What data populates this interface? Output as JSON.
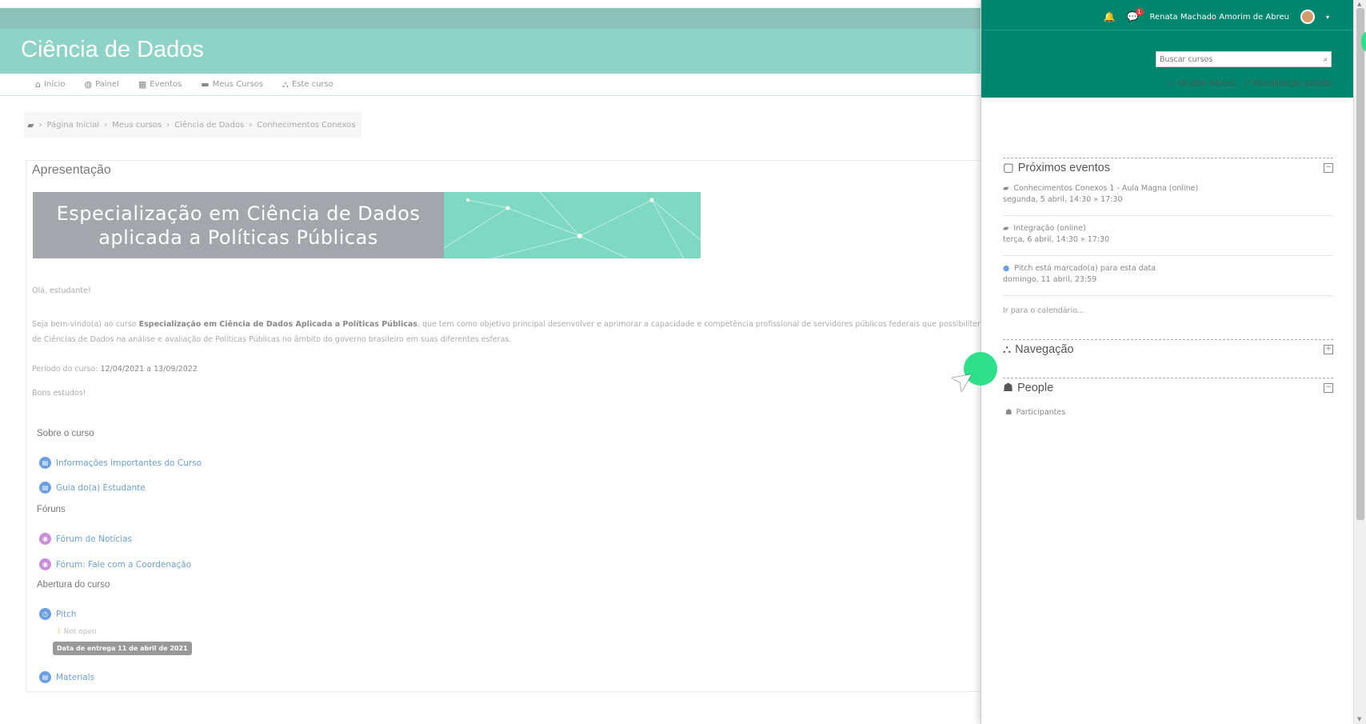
{
  "site": {
    "title": "Ciência de Dados"
  },
  "nav": [
    {
      "icon": "home-icon",
      "glyph": "⌂",
      "label": "Início"
    },
    {
      "icon": "dashboard-icon",
      "glyph": "◍",
      "label": "Painel"
    },
    {
      "icon": "calendar-icon",
      "glyph": "▦",
      "label": "Eventos"
    },
    {
      "icon": "courses-icon",
      "glyph": "▬",
      "label": "Meus Cursos"
    },
    {
      "icon": "sitemap-icon",
      "glyph": "⛬",
      "label": "Este curso"
    }
  ],
  "breadcrumb": {
    "items": [
      "Página Inicial",
      "Meus cursos",
      "Ciência de Dados",
      "Conhecimentos Conexos"
    ]
  },
  "main": {
    "section_title": "Apresentação",
    "banner": {
      "line1": "Especialização em Ciência de Dados",
      "line2": "aplicada a Políticas Públicas"
    },
    "greeting": "Olá, estudante!",
    "welcome_prefix": "Seja bem-vindo(a) ao curso ",
    "welcome_bold": "Especialização em Ciência de Dados Aplicada a Políticas Públicas",
    "welcome_suffix": ", que tem como objetivo principal desenvolver e aprimorar a capacidade e competência profissional de servidores públicos federais que possibilitem aplicar os conhecimentos",
    "welcome_line2": "de Ciências de Dados na análise e avaliação de Políticas Públicas no âmbito do governo brasileiro em suas diferentes esferas.",
    "period_label": "Período do curso: ",
    "period_value": "12/04/2021 a 13/09/2022",
    "closing": "Bons estudos!",
    "groups": {
      "sobre": "Sobre o curso",
      "foruns": "Fóruns",
      "abertura": "Abertura do curso"
    },
    "activities": {
      "info": "Informações Importantes do Curso",
      "guia": "Guia do(a) Estudante",
      "forum_noticias": "Fórum de Notícias",
      "forum_coord": "Fórum: Fale com a Coordenação",
      "pitch": "Pitch",
      "materials": "Materials"
    },
    "not_open": "Not open",
    "due_badge": "Data de entrega 11 de abril de 2021"
  },
  "drawer": {
    "user_name": "Renata Machado Amorim de Abreu",
    "notif_count": "1",
    "search_placeholder": "Buscar cursos",
    "hide_blocks": "Ocultar blocos",
    "default_view": "Visualização padrão",
    "upcoming": {
      "title": "Próximos eventos",
      "events": [
        {
          "name": "Conhecimentos Conexos 1 - Aula Magna (online)",
          "time": "segunda, 5 abril, 14:30 » 17:30"
        },
        {
          "name": "Integração (online)",
          "time": "terça, 6 abril, 14:30 » 17:30"
        },
        {
          "name": "Pitch está marcado(a) para esta data",
          "time": "domingo, 11 abril, 23:59"
        }
      ],
      "calendar_link": "Ir para o calendário..."
    },
    "navigation": {
      "title": "Navegação"
    },
    "people": {
      "title": "People",
      "participants": "Participantes"
    }
  }
}
